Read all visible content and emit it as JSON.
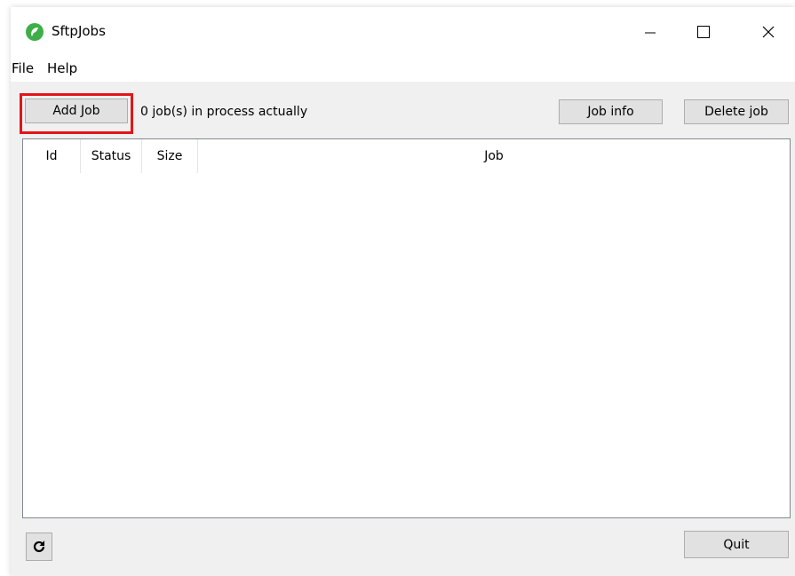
{
  "window": {
    "title": "SftpJobs",
    "icon": "sftpjobs-app-icon",
    "controls": [
      "minimize-icon",
      "maximize-icon",
      "close-icon"
    ]
  },
  "menu": {
    "file": "File",
    "help": "Help"
  },
  "toolbar": {
    "add_job": "Add Job",
    "status": "0 job(s) in process actually",
    "job_info": "Job info",
    "delete_job": "Delete job"
  },
  "table": {
    "columns": [
      "Id",
      "Status",
      "Size",
      "Job"
    ],
    "rows": []
  },
  "footer": {
    "refresh_icon": "refresh-icon",
    "quit": "Quit"
  },
  "colors": {
    "highlight": "#e3151a",
    "app_icon": "#3fae49"
  }
}
